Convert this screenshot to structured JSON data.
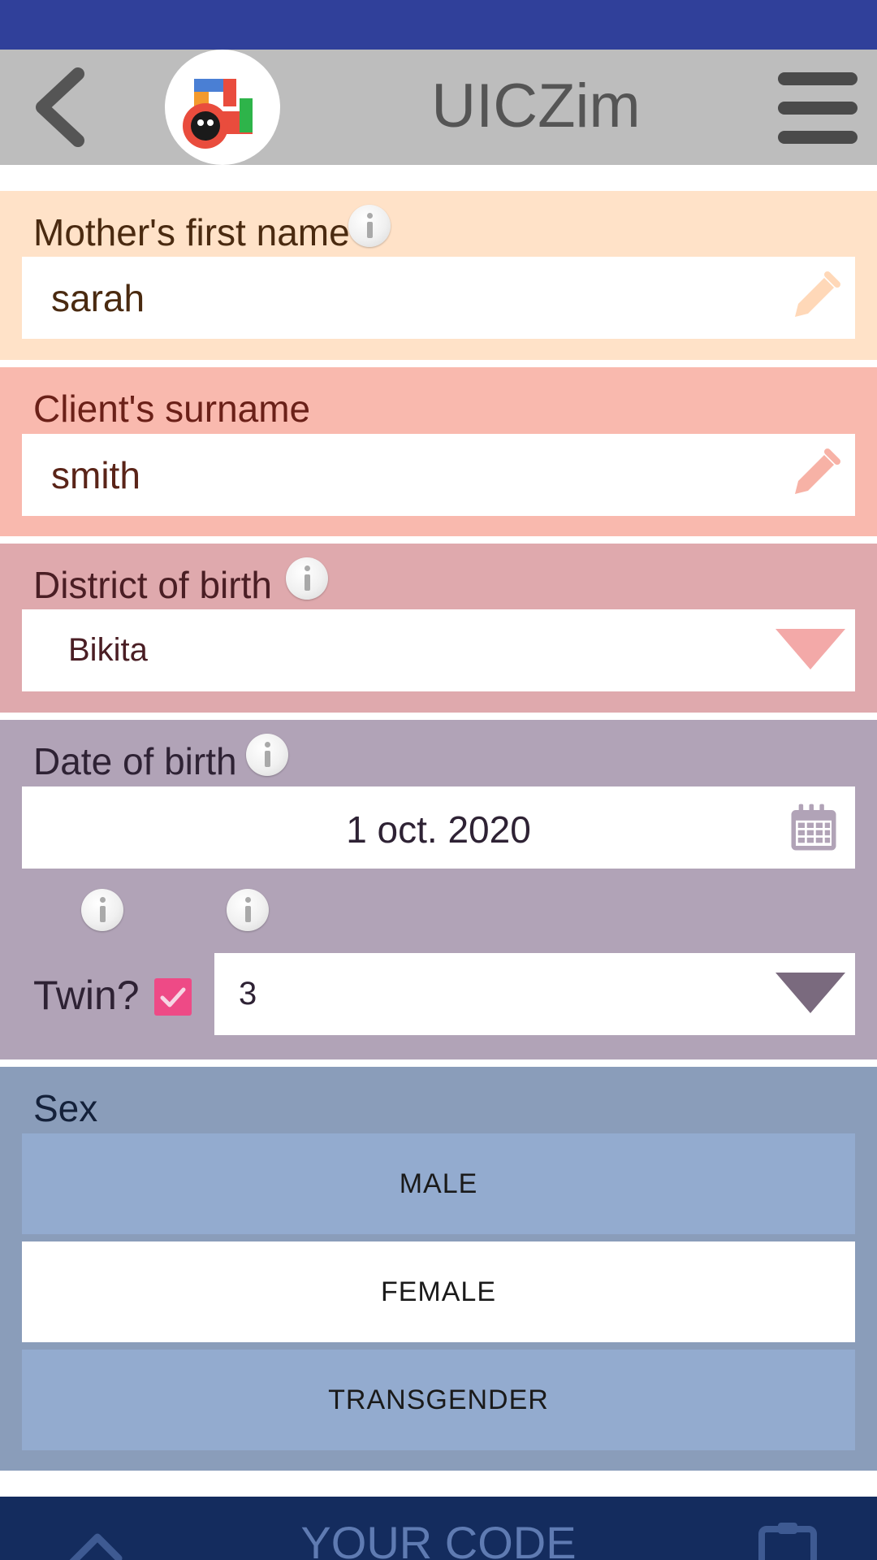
{
  "app": {
    "title": "UICZim"
  },
  "form": {
    "mother_first_name": {
      "label": "Mother's first name",
      "value": "sarah"
    },
    "client_surname": {
      "label": "Client's surname",
      "value": "smith"
    },
    "district_of_birth": {
      "label": "District of birth",
      "value": "Bikita"
    },
    "date_of_birth": {
      "label": "Date of birth",
      "value": "1 oct. 2020"
    },
    "twin": {
      "label": "Twin?",
      "checked": true,
      "count": "3"
    },
    "sex": {
      "label": "Sex",
      "options": [
        "MALE",
        "FEMALE",
        "TRANSGENDER"
      ],
      "selected": "FEMALE"
    }
  },
  "footer": {
    "code_label": "YOUR CODE"
  },
  "colors": {
    "status_bar": "#30409a",
    "app_bar": "#bdbdbd",
    "section_mother": "#ffe2c8",
    "section_surname": "#f9b9ae",
    "section_district": "#dfa9ad",
    "section_dob": "#b1a3b7",
    "section_sex": "#8a9dba",
    "sex_button": "#93abcf",
    "checkbox": "#ee4a86",
    "bottom_bar": "#142c5e"
  }
}
